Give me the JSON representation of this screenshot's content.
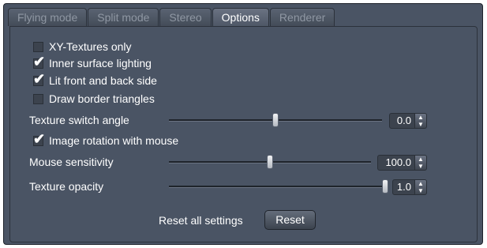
{
  "tabs": [
    {
      "label": "Flying mode",
      "active": false
    },
    {
      "label": "Split mode",
      "active": false
    },
    {
      "label": "Stereo",
      "active": false
    },
    {
      "label": "Options",
      "active": true
    },
    {
      "label": "Renderer",
      "active": false
    }
  ],
  "checkboxes": {
    "xy_textures": {
      "label": "XY-Textures only",
      "checked": false
    },
    "inner_lighting": {
      "label": "Inner surface lighting",
      "checked": true
    },
    "lit_front_back": {
      "label": "Lit front and back side",
      "checked": true
    },
    "draw_border": {
      "label": "Draw border triangles",
      "checked": false
    },
    "image_rotation": {
      "label": "Image rotation with mouse",
      "checked": true
    }
  },
  "sliders": {
    "texture_switch_angle": {
      "label": "Texture switch angle",
      "value": "0.0",
      "position_fraction": 0.5
    },
    "mouse_sensitivity": {
      "label": "Mouse sensitivity",
      "value": "100.0",
      "position_fraction": 0.5
    },
    "texture_opacity": {
      "label": "Texture opacity",
      "value": "1.0",
      "position_fraction": 1.0
    }
  },
  "reset": {
    "label": "Reset all settings",
    "button": "Reset"
  },
  "colors": {
    "panel_bg": "#4a5464",
    "text": "#ffffff",
    "inactive_tab_text": "#8f97a3"
  }
}
